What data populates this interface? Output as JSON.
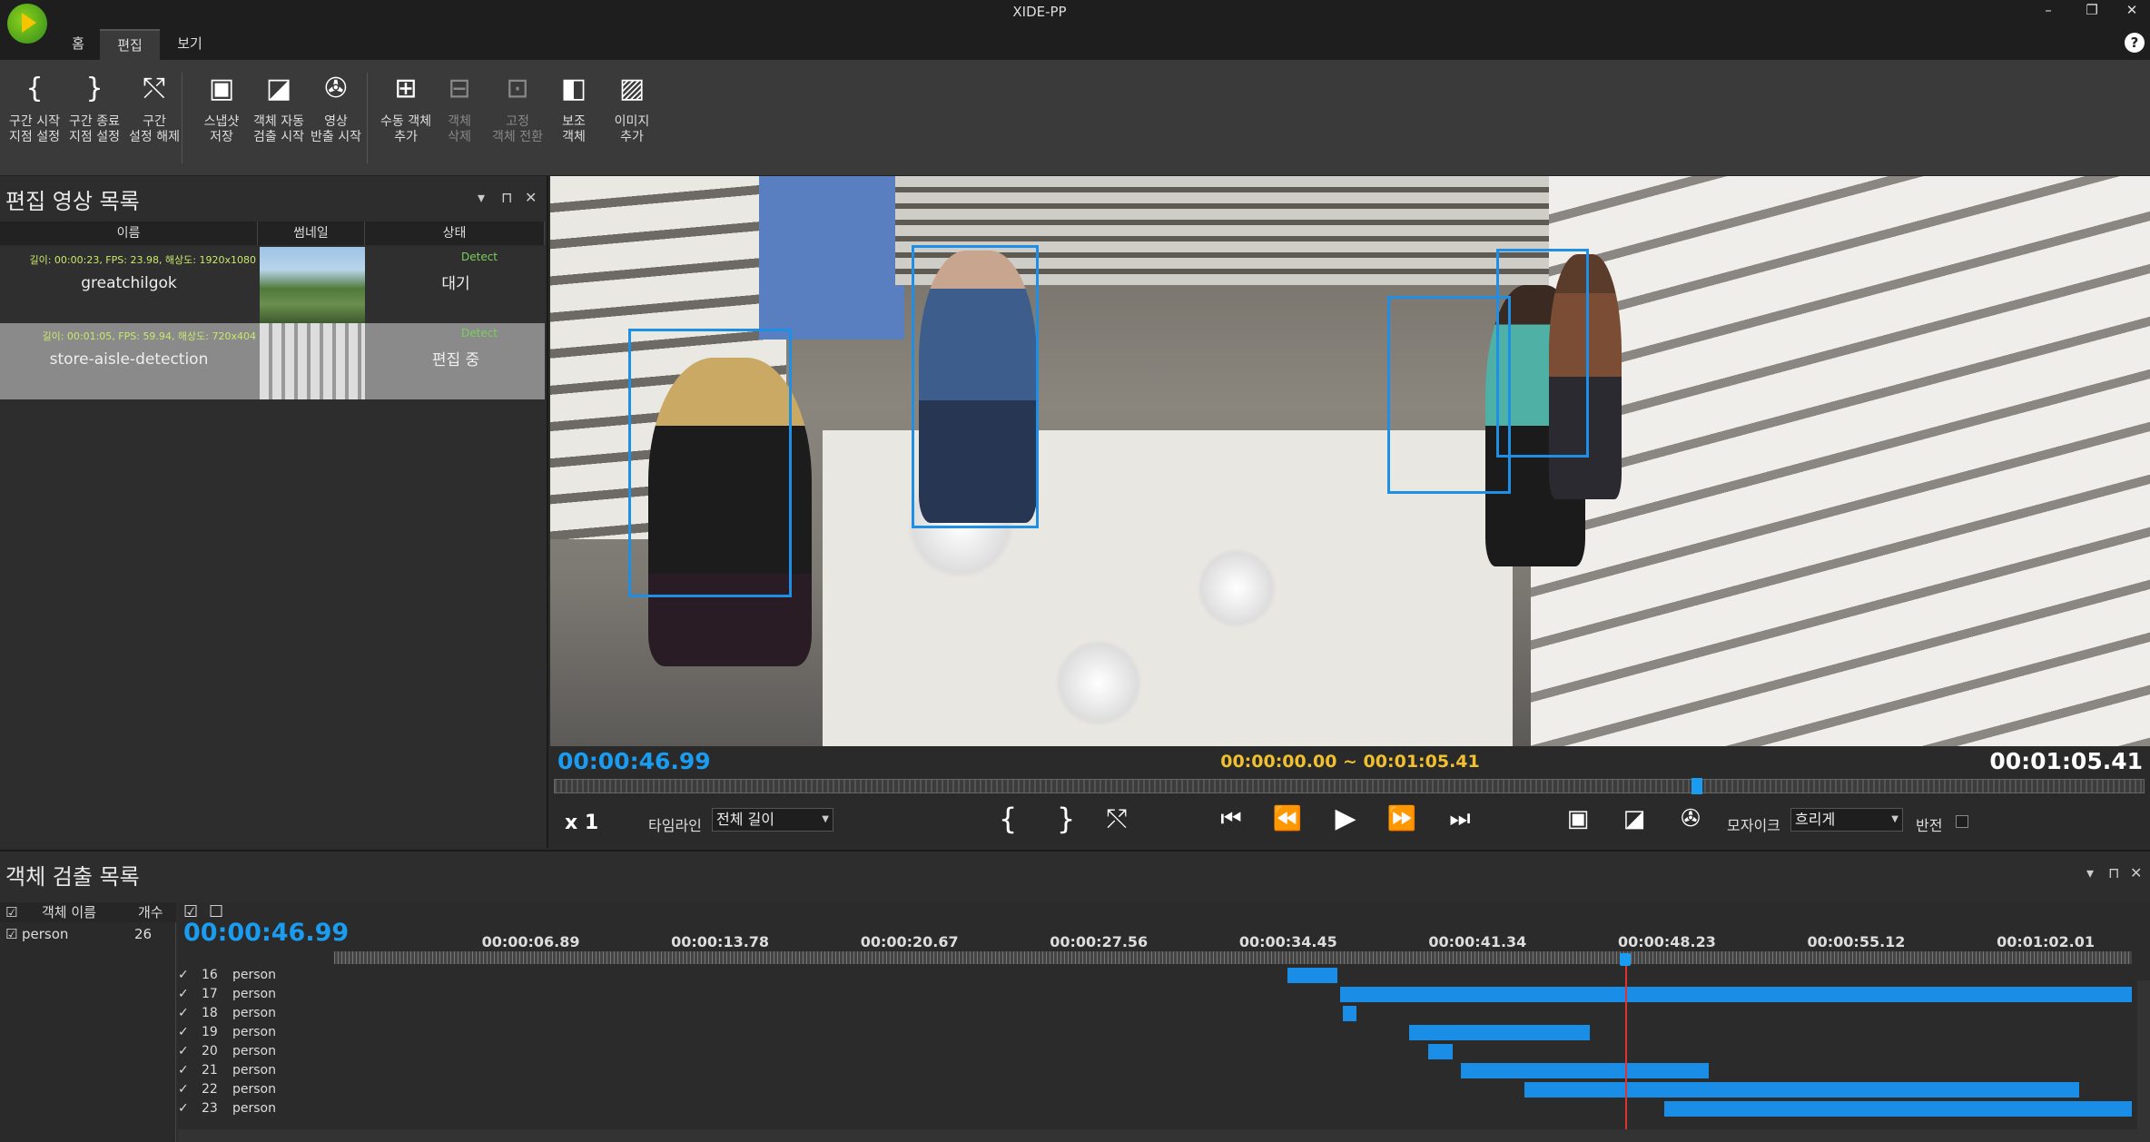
{
  "app": {
    "title": "XIDE-PP",
    "minimize": "–",
    "restore": "❐",
    "close": "✕",
    "help": "?"
  },
  "tabs": [
    "홈",
    "편집",
    "보기"
  ],
  "ribbon": [
    {
      "icon": "{",
      "label": "구간 시작\n지점 설정",
      "name": "range-start-button",
      "dim": false
    },
    {
      "icon": "}",
      "label": "구간 종료\n지점 설정",
      "name": "range-end-button",
      "dim": false
    },
    {
      "icon": "⤲",
      "label": "구간\n설정 해제",
      "name": "range-clear-button",
      "dim": false
    },
    {
      "icon": "▣",
      "label": "스냅샷\n저장",
      "name": "snapshot-button",
      "dim": false
    },
    {
      "icon": "◪",
      "label": "객체 자동\n검출 시작",
      "name": "auto-detect-button",
      "dim": false
    },
    {
      "icon": "✇",
      "label": "영상\n반출 시작",
      "name": "export-video-button",
      "dim": false
    },
    {
      "icon": "⊞",
      "label": "수동 객체\n추가",
      "name": "manual-add-object-button",
      "dim": false
    },
    {
      "icon": "⊟",
      "label": "객체\n삭제",
      "name": "delete-object-button",
      "dim": true
    },
    {
      "icon": "⊡",
      "label": "고정\n객체 전환",
      "name": "fixed-object-button",
      "dim": true
    },
    {
      "icon": "◧",
      "label": "보조\n객체",
      "name": "aux-object-button",
      "dim": false
    },
    {
      "icon": "▨",
      "label": "이미지\n추가",
      "name": "add-image-button",
      "dim": false
    }
  ],
  "video_list": {
    "title": "편집 영상 목록",
    "columns": [
      "이름",
      "썸네일",
      "상태"
    ],
    "rows": [
      {
        "meta": "길이: 00:00:23, FPS: 23.98, 해상도: 1920x1080",
        "name": "greatchilgok",
        "detect": "Detect",
        "status": "대기",
        "selected": false
      },
      {
        "meta": "길이: 00:01:05, FPS: 59.94, 해상도: 720x404",
        "name": "store-aisle-detection",
        "detect": "Detect",
        "status": "편집 중",
        "selected": true
      }
    ]
  },
  "player": {
    "current_time": "00:00:46.99",
    "range": "00:00:00.00 ~ 00:01:05.41",
    "total_time": "00:01:05.41",
    "progress": 0.718,
    "speed": "x 1",
    "timeline_label": "타임라인",
    "timeline_value": "전체 길이",
    "mosaic_label": "모자이크",
    "mosaic_value": "흐리게",
    "invert_label": "반전"
  },
  "objects": {
    "title": "객체 검출 목록",
    "columns": [
      "객체 이름",
      "개수"
    ],
    "items": [
      {
        "name": "person",
        "count": "26"
      }
    ]
  },
  "timeline": {
    "current_time": "00:00:46.99",
    "ticks": [
      "00:00:06.89",
      "00:00:13.78",
      "00:00:20.67",
      "00:00:27.56",
      "00:00:34.45",
      "00:00:41.34",
      "00:00:48.23",
      "00:00:55.12",
      "00:01:02.01"
    ],
    "duration_s": 65.41,
    "tracks": [
      {
        "id": "16",
        "name": "person",
        "start": 34.7,
        "end": 36.5
      },
      {
        "id": "17",
        "name": "person",
        "start": 36.6,
        "end": 65.4
      },
      {
        "id": "18",
        "name": "person",
        "start": 36.7,
        "end": 37.2
      },
      {
        "id": "19",
        "name": "person",
        "start": 39.1,
        "end": 45.7
      },
      {
        "id": "20",
        "name": "person",
        "start": 39.8,
        "end": 40.7
      },
      {
        "id": "21",
        "name": "person",
        "start": 41.0,
        "end": 50.0
      },
      {
        "id": "22",
        "name": "person",
        "start": 43.3,
        "end": 63.5
      },
      {
        "id": "23",
        "name": "person",
        "start": 48.4,
        "end": 65.4
      }
    ]
  }
}
